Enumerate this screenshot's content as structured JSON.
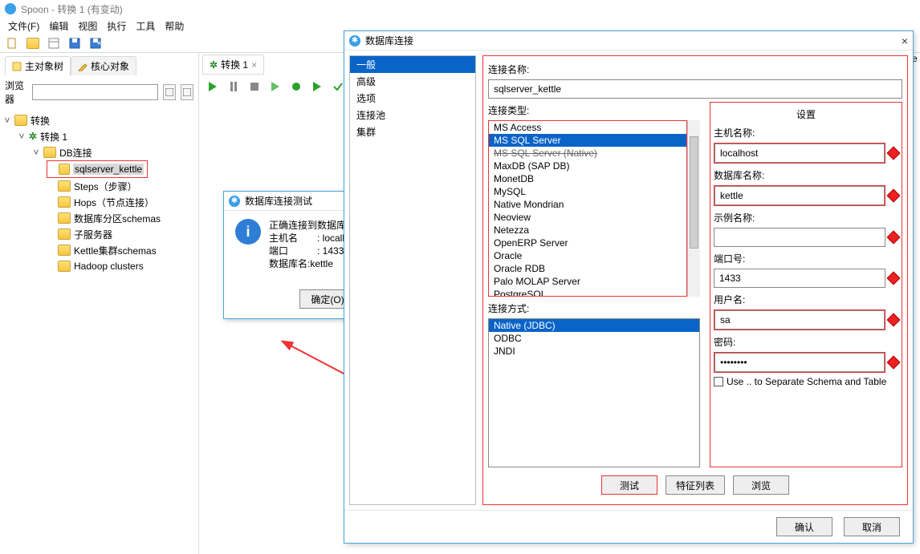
{
  "window": {
    "title": "Spoon - 转换 1 (有变动)"
  },
  "menu": {
    "file": "文件(F)",
    "edit": "编辑",
    "view": "视图",
    "exec": "执行",
    "tools": "工具",
    "help": "帮助"
  },
  "left_tabs": {
    "tree": "主对象树",
    "core": "核心对象"
  },
  "browser_label": "浏览器",
  "tree": {
    "root": "转换",
    "t1": "转换 1",
    "db": "DB连接",
    "dbconn": "sqlserver_kettle",
    "steps": "Steps（步骤）",
    "hops": "Hops（节点连接）",
    "part": "数据库分区schemas",
    "slave": "子服务器",
    "kettle": "Kettle集群schemas",
    "hadoop": "Hadoop clusters"
  },
  "center_tab": {
    "label": "转换 1"
  },
  "right_trunc": "Pe",
  "dlg_test": {
    "title": "数据库连接测试",
    "line1": "正确连接到数据库[sqlserver_kettle]",
    "line2": "主机名　　: localhost",
    "line3": "端口　　　: 1433",
    "line4": "数据库名:kettle",
    "ok": "确定(O)"
  },
  "dlg_conn": {
    "title": "数据库连接",
    "cats": [
      "一般",
      "高级",
      "选项",
      "连接池",
      "集群"
    ],
    "conn_name_lbl": "连接名称:",
    "conn_name": "sqlserver_kettle",
    "conn_type_lbl": "连接类型:",
    "types": [
      "MS Access",
      "MS SQL Server",
      "MS SQL Server (Native)",
      "MaxDB (SAP DB)",
      "MonetDB",
      "MySQL",
      "Native Mondrian",
      "Neoview",
      "Netezza",
      "OpenERP Server",
      "Oracle",
      "Oracle RDB",
      "Palo MOLAP Server",
      "PostgreSQL"
    ],
    "type_selected": "MS SQL Server",
    "type_strike": "MS SQL Server (Native)",
    "conn_mode_lbl": "连接方式:",
    "modes": [
      "Native (JDBC)",
      "ODBC",
      "JNDI"
    ],
    "mode_selected": "Native (JDBC)",
    "settings_lbl": "设置",
    "host_lbl": "主机名称:",
    "host": "localhost",
    "dbname_lbl": "数据库名称:",
    "dbname": "kettle",
    "instance_lbl": "示例名称:",
    "instance": "",
    "port_lbl": "端口号:",
    "port": "1433",
    "user_lbl": "用户名:",
    "user": "sa",
    "pass_lbl": "密码:",
    "pass": "********",
    "use_sep": "Use .. to Separate Schema and Table",
    "btn_test": "测试",
    "btn_feat": "特征列表",
    "btn_browse": "浏览",
    "btn_ok": "确认",
    "btn_cancel": "取消"
  }
}
